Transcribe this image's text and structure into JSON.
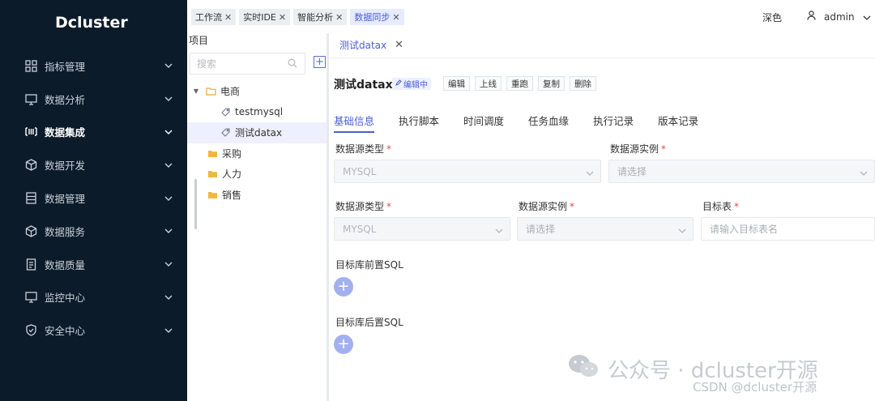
{
  "brand": "Dcluster",
  "sidebar": {
    "items": [
      {
        "label": "指标管理",
        "icon": "grid-icon"
      },
      {
        "label": "数据分析",
        "icon": "monitor-icon"
      },
      {
        "label": "数据集成",
        "icon": "barcode-icon"
      },
      {
        "label": "数据开发",
        "icon": "cube-icon"
      },
      {
        "label": "数据管理",
        "icon": "server-icon"
      },
      {
        "label": "数据服务",
        "icon": "box-icon"
      },
      {
        "label": "数据质量",
        "icon": "document-icon"
      },
      {
        "label": "监控中心",
        "icon": "display-icon"
      },
      {
        "label": "安全中心",
        "icon": "shield-icon"
      }
    ],
    "active_index": 2
  },
  "top_tabs": [
    {
      "label": "工作流"
    },
    {
      "label": "实时IDE"
    },
    {
      "label": "智能分析"
    },
    {
      "label": "数据同步"
    }
  ],
  "header": {
    "theme_label": "深色",
    "username": "admin"
  },
  "tree_panel": {
    "title": "项目",
    "search_placeholder": "搜索",
    "add_label": "+",
    "nodes": [
      {
        "label": "电商",
        "type": "folder-open"
      },
      {
        "label": "testmysql",
        "type": "file"
      },
      {
        "label": "测试datax",
        "type": "file"
      },
      {
        "label": "采购",
        "type": "folder"
      },
      {
        "label": "人力",
        "type": "folder"
      },
      {
        "label": "销售",
        "type": "folder"
      }
    ]
  },
  "main": {
    "file_tab": "测试datax",
    "title": "测试datax",
    "badge": "编辑中",
    "actions": [
      "编辑",
      "上线",
      "重跑",
      "复制",
      "删除"
    ],
    "sub_tabs": [
      "基础信息",
      "执行脚本",
      "时间调度",
      "任务血缘",
      "执行记录",
      "版本记录"
    ],
    "source_section": {
      "type_label": "数据源类型",
      "type_value": "MYSQL",
      "instance_label": "数据源实例",
      "instance_placeholder": "请选择"
    },
    "target_section": {
      "type_label": "数据源类型",
      "type_value": "MYSQL",
      "instance_label": "数据源实例",
      "instance_placeholder": "请选择",
      "table_label": "目标表",
      "table_placeholder": "请输入目标表名"
    },
    "pre_sql_label": "目标库前置SQL",
    "post_sql_label": "目标库后置SQL",
    "required_mark": "*",
    "plus_symbol": "+"
  },
  "watermark": {
    "line1": "公众号 · dcluster开源",
    "line2": "CSDN @dcluster开源"
  },
  "colors": {
    "sidebar_bg": "#0c1b2a",
    "accent": "#4a5fd0",
    "required": "#e5484d"
  }
}
